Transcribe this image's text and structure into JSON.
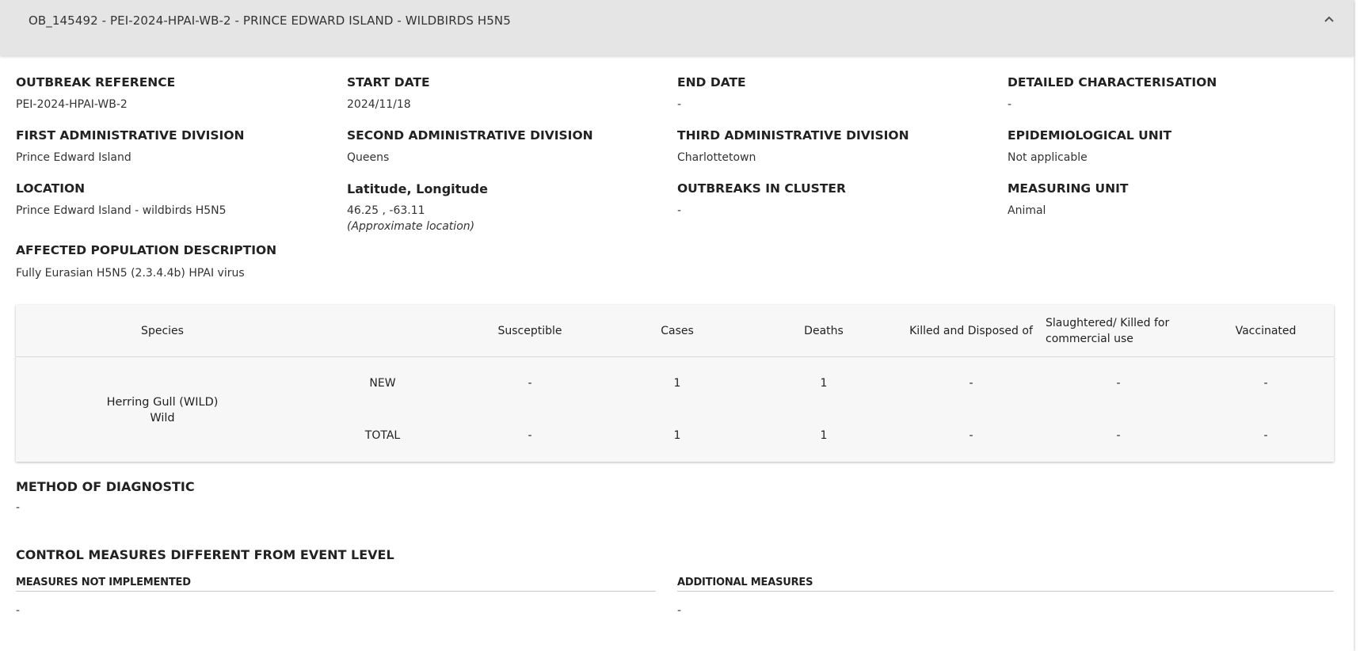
{
  "panel": {
    "title": "OB_145492 - PEI-2024-HPAI-WB-2 - PRINCE EDWARD ISLAND - WILDBIRDS H5N5"
  },
  "fields": {
    "outbreak_reference": {
      "label": "OUTBREAK REFERENCE",
      "value": "PEI-2024-HPAI-WB-2"
    },
    "start_date": {
      "label": "START DATE",
      "value": "2024/11/18"
    },
    "end_date": {
      "label": "END DATE",
      "value": "-"
    },
    "detailed_characterisation": {
      "label": "DETAILED CHARACTERISATION",
      "value": "-"
    },
    "first_admin_division": {
      "label": "FIRST ADMINISTRATIVE DIVISION",
      "value": "Prince Edward Island"
    },
    "second_admin_division": {
      "label": "SECOND ADMINISTRATIVE DIVISION",
      "value": "Queens"
    },
    "third_admin_division": {
      "label": "THIRD ADMINISTRATIVE DIVISION",
      "value": "Charlottetown"
    },
    "epidemiological_unit": {
      "label": "EPIDEMIOLOGICAL UNIT",
      "value": "Not applicable"
    },
    "location": {
      "label": "LOCATION",
      "value": "Prince Edward Island - wildbirds H5N5"
    },
    "lat_long": {
      "label": "Latitude, Longitude",
      "value": "46.25 , -63.11",
      "note": "(Approximate location)"
    },
    "outbreaks_in_cluster": {
      "label": "OUTBREAKS IN CLUSTER",
      "value": "-"
    },
    "measuring_unit": {
      "label": "MEASURING UNIT",
      "value": "Animal"
    },
    "affected_population": {
      "label": "AFFECTED POPULATION DESCRIPTION",
      "value": "Fully Eurasian H5N5 (2.3.4.4b) HPAI virus"
    }
  },
  "table": {
    "headers": {
      "species": "Species",
      "susceptible": "Susceptible",
      "cases": "Cases",
      "deaths": "Deaths",
      "killed_disposed": "Killed and Disposed of",
      "slaughtered": "Slaughtered/ Killed for commercial use",
      "vaccinated": "Vaccinated"
    },
    "species_name": "Herring Gull (WILD)",
    "species_type": "Wild",
    "rows": [
      {
        "kind": "NEW",
        "susceptible": "-",
        "cases": "1",
        "deaths": "1",
        "killed_disposed": "-",
        "slaughtered": "-",
        "vaccinated": "-"
      },
      {
        "kind": "TOTAL",
        "susceptible": "-",
        "cases": "1",
        "deaths": "1",
        "killed_disposed": "-",
        "slaughtered": "-",
        "vaccinated": "-"
      }
    ]
  },
  "diagnostic": {
    "title": "METHOD OF DIAGNOSTIC",
    "value": "-"
  },
  "control_measures": {
    "title": "CONTROL MEASURES DIFFERENT FROM EVENT LEVEL",
    "not_implemented": {
      "label": "MEASURES NOT IMPLEMENTED",
      "value": "-"
    },
    "additional": {
      "label": "ADDITIONAL MEASURES",
      "value": "-"
    }
  },
  "icons": {
    "collapse": "chevron-up-icon"
  }
}
